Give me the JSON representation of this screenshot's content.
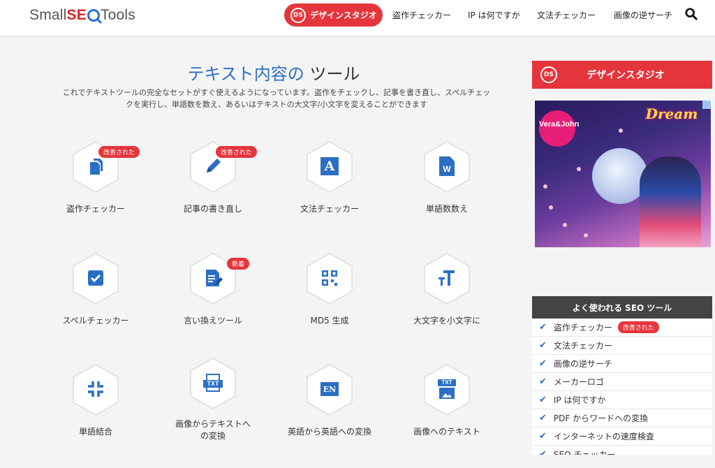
{
  "header": {
    "logo": {
      "part1": "Small",
      "part2": "SE",
      "part3": "Tools"
    },
    "design_studio": "デザインスタジオ",
    "nav": [
      "盗作チェッカー",
      "IP は何ですか",
      "文法チェッカー",
      "画像の逆サーチ"
    ]
  },
  "main": {
    "title_blue": "テキスト内容の",
    "title_dark": "ツール",
    "description": "これでテキストツールの完全なセットがすぐ使えるようになっています。盗作をチェックし、記事を書き直し、スペルチェックを実行し、単語数を数え、あるいはテキストの大文字/小文字を変えることができます",
    "tools": [
      {
        "label": "盗作チェッカー",
        "badge": "改善された",
        "icon": "copy-icon"
      },
      {
        "label": "記事の書き直し",
        "badge": "改善された",
        "icon": "pencil-icon"
      },
      {
        "label": "文法チェッカー",
        "badge": "",
        "icon": "letter-a-icon"
      },
      {
        "label": "単語数数え",
        "badge": "",
        "icon": "word-doc-icon"
      },
      {
        "label": "スペルチェッカー",
        "badge": "",
        "icon": "checkbox-icon"
      },
      {
        "label": "言い換えツール",
        "badge": "新着",
        "icon": "doc-edit-icon"
      },
      {
        "label": "MD5 生成",
        "badge": "",
        "icon": "qr-icon"
      },
      {
        "label": "大文字を小文字に",
        "badge": "",
        "icon": "text-case-icon"
      },
      {
        "label": "単語結合",
        "badge": "",
        "icon": "compress-icon"
      },
      {
        "label": "画像からテキストへの変換",
        "badge": "",
        "icon": "txt-icon"
      },
      {
        "label": "英語から英語への変換",
        "badge": "",
        "icon": "en-icon"
      },
      {
        "label": "画像へのテキスト",
        "badge": "",
        "icon": "txt-image-icon"
      }
    ],
    "icon_text": {
      "a": "A",
      "w": "W",
      "txt": "TXT",
      "en": "EN"
    }
  },
  "sidebar": {
    "banner": "デザインスタジオ",
    "ad": {
      "brand": "Vera&John",
      "headline": "Dream"
    },
    "popular_title": "よく使われる SEO ツール",
    "popular": [
      {
        "label": "盗作チェッカー",
        "badge": "改善された"
      },
      {
        "label": "文法チェッカー",
        "badge": ""
      },
      {
        "label": "画像の逆サーチ",
        "badge": ""
      },
      {
        "label": "メーカーロゴ",
        "badge": ""
      },
      {
        "label": "IP は何ですか",
        "badge": ""
      },
      {
        "label": "PDF からワードへの変換",
        "badge": ""
      },
      {
        "label": "インターネットの速度検査",
        "badge": ""
      },
      {
        "label": "SEO チェッカー",
        "badge": ""
      }
    ]
  },
  "colors": {
    "accent_red": "#e5353c",
    "blue": "#2b6fc4",
    "dark": "#444444"
  }
}
